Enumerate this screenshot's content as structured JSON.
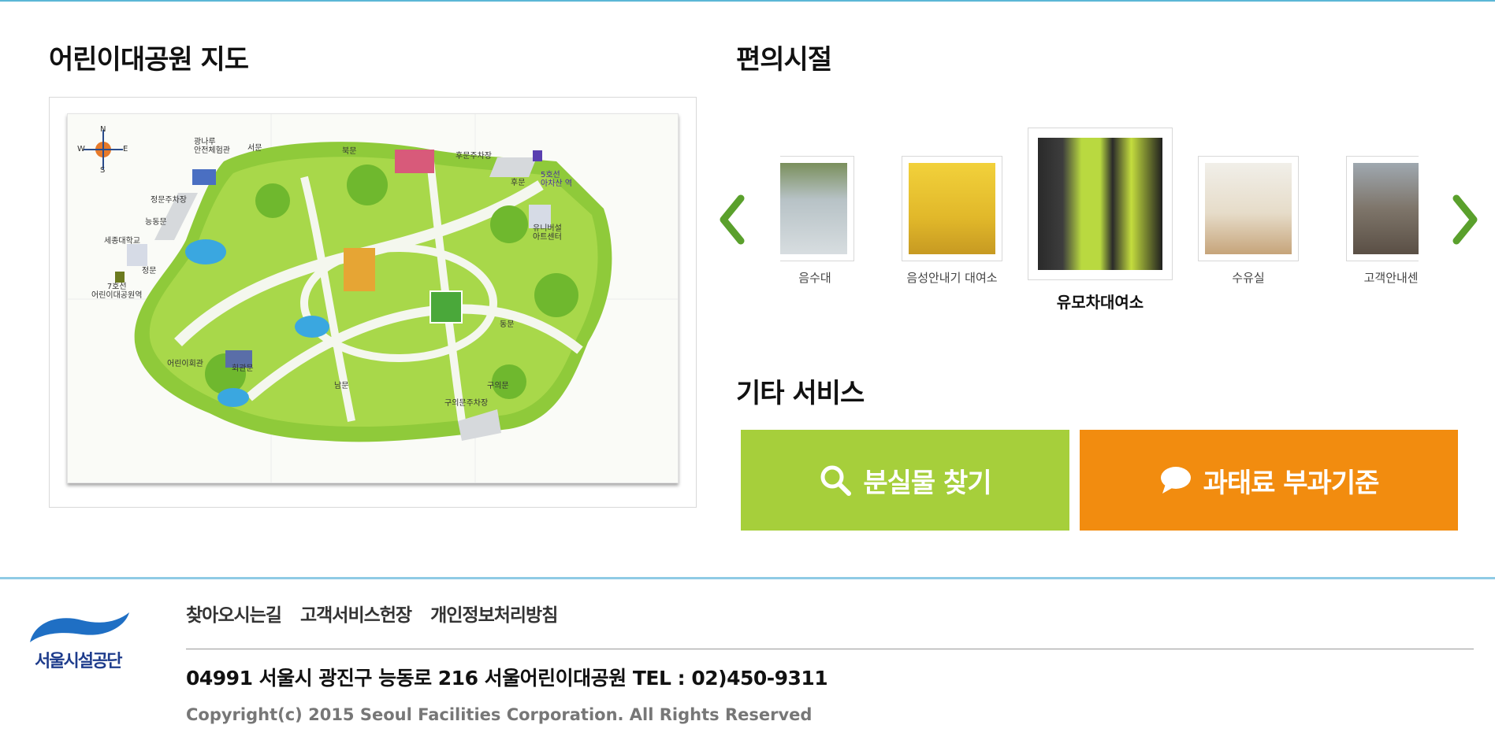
{
  "map_section": {
    "title": "어린이대공원 지도",
    "labels": {
      "compass_n": "N",
      "compass_s": "S",
      "compass_e": "E",
      "compass_w": "W",
      "west_gate": "서문",
      "north_gate": "북문",
      "rear_parking": "후문주차장",
      "rear_gate": "후문",
      "line5_station": "5호선\n아차산 역",
      "front_parking": "정문주차장",
      "neungdong_gate": "능동문",
      "sejong_univ": "세종대학교",
      "main_gate": "정문",
      "line7_station": "7호선\n어린이대공원역",
      "childrens_hall": "어린이회관",
      "hall_gate": "회관문",
      "south_gate": "남문",
      "guui_gate": "구의문",
      "guui_parking": "구의문주차장",
      "east_gate": "동문",
      "universal_center": "유니버설\n아트센터",
      "safety_center": "광나루\n안전체험관"
    }
  },
  "facilities": {
    "title": "편의시절",
    "prev_label": "이전",
    "next_label": "다음",
    "items": [
      {
        "label": "음수대",
        "color": "#c9d2d6"
      },
      {
        "label": "음성안내기 대여소",
        "color": "#e8c236"
      },
      {
        "label": "유모차대여소",
        "color": "#b8d640",
        "active": true
      },
      {
        "label": "수유실",
        "color": "#e9e4da"
      },
      {
        "label": "고객안내센터",
        "color": "#8d8479"
      }
    ]
  },
  "services": {
    "title": "기타 서비스",
    "lost_found": "분실물 찾기",
    "fine_standard": "과태료 부과기준",
    "lost_color": "#a6cf3b",
    "fine_color": "#f28c0f"
  },
  "footer": {
    "logo_text": "서울시설공단",
    "nav": [
      "찾아오시는길",
      "고객서비스헌장",
      "개인정보처리방침"
    ],
    "address": "04991 서울시 광진구 능동로 216 서울어린이대공원 TEL : 02)450-9311",
    "copyright": "Copyright(c) 2015 Seoul Facilities Corporation. All Rights Reserved"
  },
  "icons": {
    "search": "search-icon",
    "speech": "speech-bubble-icon",
    "prev": "chevron-left-icon",
    "next": "chevron-right-icon"
  }
}
